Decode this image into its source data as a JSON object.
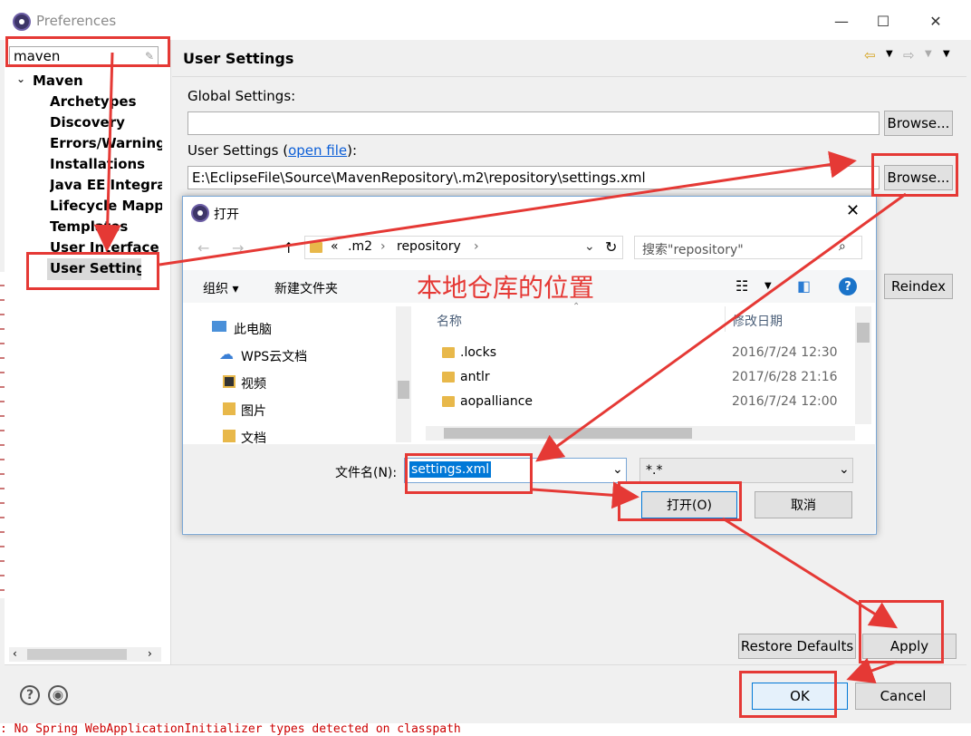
{
  "window": {
    "title": "Preferences",
    "min": "—",
    "max": "☐",
    "close": "✕"
  },
  "sidebar": {
    "filter_value": "maven",
    "root": "Maven",
    "items": [
      {
        "label": "Archetypes"
      },
      {
        "label": "Discovery"
      },
      {
        "label": "Errors/Warnings"
      },
      {
        "label": "Installations"
      },
      {
        "label": "Java EE Integration"
      },
      {
        "label": "Lifecycle Mappings"
      },
      {
        "label": "Templates"
      },
      {
        "label": "User Interface"
      },
      {
        "label": "User Settings"
      }
    ]
  },
  "page": {
    "title": "User Settings",
    "global_label": "Global Settings:",
    "global_value": "",
    "browse": "Browse...",
    "user_label_prefix": "User Settings (",
    "user_label_link": "open file",
    "user_label_suffix": "):",
    "user_value": "E:\\EclipseFile\\Source\\MavenRepository\\.m2\\repository\\settings.xml",
    "reindex": "Reindex",
    "restore": "Restore Defaults",
    "apply": "Apply"
  },
  "footer": {
    "ok": "OK",
    "cancel": "Cancel",
    "help": "?"
  },
  "console": {
    "line": ": No Spring WebApplicationInitializer types detected on classpath"
  },
  "dialog": {
    "title": "打开",
    "breadcrumb": [
      "«",
      ".m2",
      "repository"
    ],
    "search_placeholder": "搜索\"repository\"",
    "organize": "组织 ▾",
    "new_folder": "新建文件夹",
    "annotation": "本地仓库的位置",
    "nav": [
      "此电脑",
      "WPS云文档",
      "视频",
      "图片",
      "文档"
    ],
    "col_name": "名称",
    "col_date": "修改日期",
    "files": [
      {
        "name": ".locks",
        "date": "2016/7/24 12:30"
      },
      {
        "name": "antlr",
        "date": "2017/6/28 21:16"
      },
      {
        "name": "aopalliance",
        "date": "2016/7/24 12:00"
      }
    ],
    "filename_label": "文件名(N):",
    "filename_value": "settings.xml",
    "filter": "*.*",
    "open": "打开(O)",
    "cancel": "取消"
  },
  "colors": {
    "annotation_red": "#e53935",
    "link_blue": "#0b5ed7",
    "accent": "#0078d7"
  }
}
